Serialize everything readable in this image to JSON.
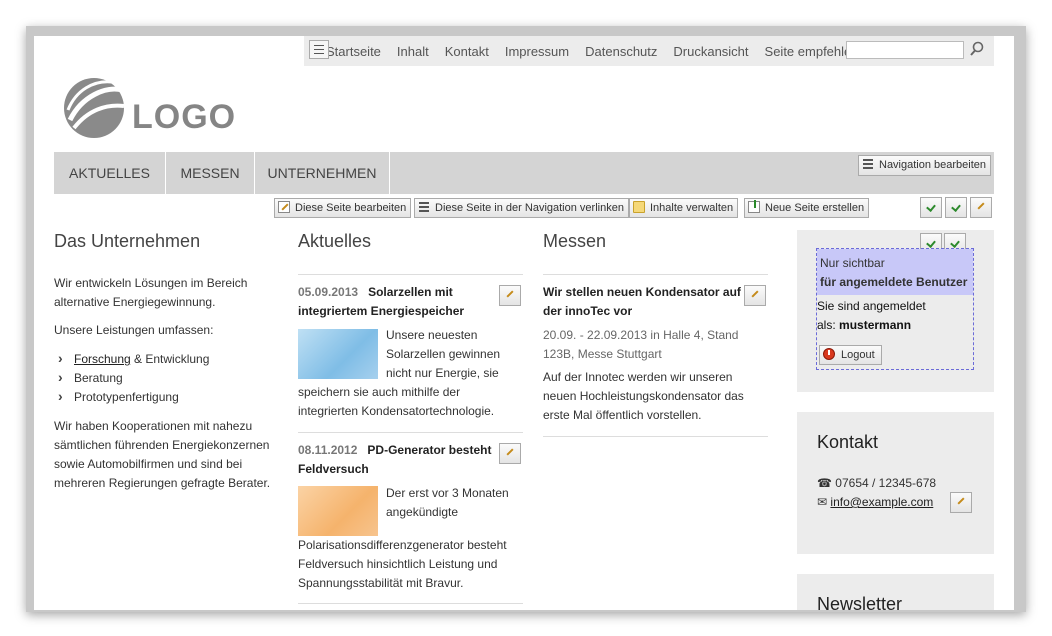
{
  "top_nav": {
    "items": [
      "Startseite",
      "Inhalt",
      "Kontakt",
      "Impressum",
      "Datenschutz",
      "Druckansicht",
      "Seite empfehlen"
    ],
    "search_value": ""
  },
  "logo": {
    "text": "LOGO"
  },
  "main_nav": {
    "tabs": [
      "AKTUELLES",
      "MESSEN",
      "UNTERNEHMEN"
    ],
    "edit_button": "Navigation bearbeiten"
  },
  "toolbar": {
    "edit_page": "Diese Seite bearbeiten",
    "link_nav": "Diese Seite in der Navigation verlinken",
    "manage": "Inhalte verwalten",
    "new_page": "Neue Seite erstellen"
  },
  "col_company": {
    "title": "Das Unternehmen",
    "intro": "Wir entwickeln Lösungen im Bereich alternative Energiegewinnung.",
    "services_label": "Unsere Leistungen umfassen:",
    "services": [
      {
        "link": "Forschung",
        "rest": " & Entwicklung"
      },
      {
        "link": "",
        "rest": "Beratung"
      },
      {
        "link": "",
        "rest": "Prototypenfertigung"
      }
    ],
    "outro": "Wir haben Kooperationen mit nahezu sämtlichen führenden Energiekonzernen sowie Automobilfirmen und sind bei mehreren Regierungen gefragte Berater."
  },
  "col_news": {
    "title": "Aktuelles",
    "items": [
      {
        "date": "05.09.2013",
        "headline": "Solarzellen mit integriertem Energiespeicher",
        "body_short": "Unsere neuesten Solarzellen gewinnen nicht nur Energie, sie",
        "body_rest": "speichern sie auch mithilfe der integrierten Kondensatortechnologie."
      },
      {
        "date": "08.11.2012",
        "headline": "PD-Generator besteht Feldversuch",
        "body_short": "Der erst vor 3 Monaten angekündigte",
        "body_rest": "Polarisationsdifferenzgenerator besteht Feldversuch hinsichtlich Leistung und Spannungsstabilität mit Bravur."
      }
    ]
  },
  "col_fairs": {
    "title": "Messen",
    "items": [
      {
        "headline": "Wir stellen neuen Kondensator auf der innoTec vor",
        "meta": "20.09. - 22.09.2013 in Halle 4, Stand 123B, Messe Stuttgart",
        "body": "Auf der Innotec werden wir unseren neuen Hochleistungskondensator das erste Mal öffentlich vorstellen."
      }
    ]
  },
  "login_box": {
    "visible_line1": "Nur sichtbar",
    "visible_line2": "für angemeldete Benutzer",
    "logged_in_text": "Sie sind angemeldet",
    "as_label": "als:",
    "username": "mustermann",
    "logout": "Logout"
  },
  "contact_box": {
    "title": "Kontakt",
    "phone": "07654 / 12345-678",
    "email": "info@example.com"
  },
  "newsletter_box": {
    "title": "Newsletter"
  }
}
